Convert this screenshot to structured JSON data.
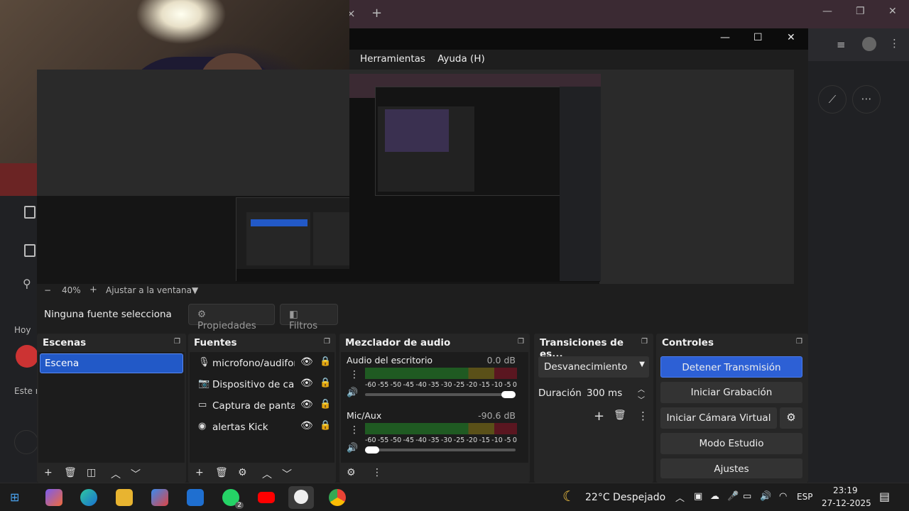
{
  "browser": {
    "new_tab": "+",
    "close_tab": "×",
    "minimize": "—",
    "maximize": "❐",
    "close": "✕",
    "side_label_hoy": "Hoy",
    "side_label_este": "Este n"
  },
  "obs": {
    "menu": [
      "Herramientas",
      "Ayuda (H)"
    ],
    "zoom": {
      "minus": "−",
      "level": "40%",
      "plus": "+",
      "fit": "Ajustar a la ventana"
    },
    "no_source": "Ninguna fuente selecciona",
    "properties_btn": "Propiedades",
    "filters_btn": "Filtros",
    "scenes": {
      "title": "Escenas",
      "items": [
        "Escena"
      ]
    },
    "sources": {
      "title": "Fuentes",
      "items": [
        {
          "icon": "mic-icon",
          "name": "microfono/audifono"
        },
        {
          "icon": "camera-icon",
          "name": "Dispositivo de captura"
        },
        {
          "icon": "monitor-icon",
          "name": "Captura de pantalla"
        },
        {
          "icon": "browser-globe-icon",
          "name": "alertas Kick"
        }
      ]
    },
    "mixer": {
      "title": "Mezclador de audio",
      "channels": [
        {
          "name": "Audio del escritorio",
          "db": "0.0 dB",
          "volume": 1.0
        },
        {
          "name": "Mic/Aux",
          "db": "-90.6 dB",
          "volume": 0.0
        }
      ],
      "scale": [
        "-60",
        "-55",
        "-50",
        "-45",
        "-40",
        "-35",
        "-30",
        "-25",
        "-20",
        "-15",
        "-10",
        "-5",
        "0"
      ]
    },
    "transitions": {
      "title": "Transiciones de es...",
      "selected": "Desvanecimiento",
      "duration_label": "Duración",
      "duration": "300 ms"
    },
    "controls": {
      "title": "Controles",
      "buttons": [
        "Detener Transmisión",
        "Iniciar Grabación",
        "Iniciar Cámara Virtual",
        "Modo Estudio",
        "Ajustes"
      ]
    }
  },
  "taskbar": {
    "weather": "22°C  Despejado",
    "lang": "ESP",
    "time": "23:19",
    "date": "27-12-2025",
    "whatsapp_badge": "2"
  },
  "colors": {
    "accent": "#2d60d5",
    "dock_bg": "#262626",
    "panel_bg": "#1c1c1c"
  }
}
